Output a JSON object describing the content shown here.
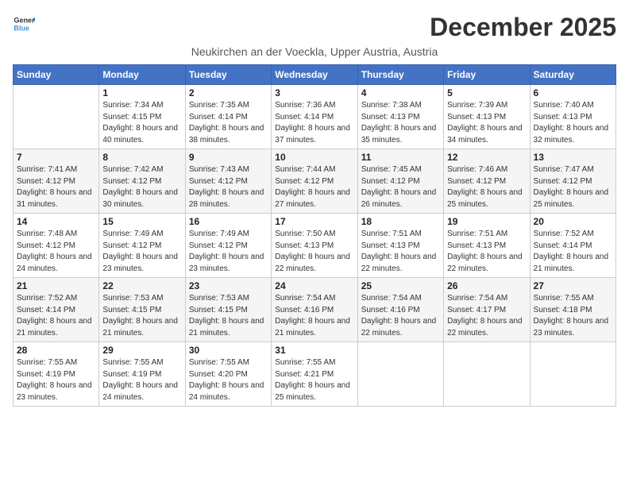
{
  "logo": {
    "line1": "General",
    "line2": "Blue"
  },
  "title": "December 2025",
  "subtitle": "Neukirchen an der Voeckla, Upper Austria, Austria",
  "headers": [
    "Sunday",
    "Monday",
    "Tuesday",
    "Wednesday",
    "Thursday",
    "Friday",
    "Saturday"
  ],
  "weeks": [
    [
      {
        "day": "",
        "sunrise": "",
        "sunset": "",
        "daylight": ""
      },
      {
        "day": "1",
        "sunrise": "Sunrise: 7:34 AM",
        "sunset": "Sunset: 4:15 PM",
        "daylight": "Daylight: 8 hours and 40 minutes."
      },
      {
        "day": "2",
        "sunrise": "Sunrise: 7:35 AM",
        "sunset": "Sunset: 4:14 PM",
        "daylight": "Daylight: 8 hours and 38 minutes."
      },
      {
        "day": "3",
        "sunrise": "Sunrise: 7:36 AM",
        "sunset": "Sunset: 4:14 PM",
        "daylight": "Daylight: 8 hours and 37 minutes."
      },
      {
        "day": "4",
        "sunrise": "Sunrise: 7:38 AM",
        "sunset": "Sunset: 4:13 PM",
        "daylight": "Daylight: 8 hours and 35 minutes."
      },
      {
        "day": "5",
        "sunrise": "Sunrise: 7:39 AM",
        "sunset": "Sunset: 4:13 PM",
        "daylight": "Daylight: 8 hours and 34 minutes."
      },
      {
        "day": "6",
        "sunrise": "Sunrise: 7:40 AM",
        "sunset": "Sunset: 4:13 PM",
        "daylight": "Daylight: 8 hours and 32 minutes."
      }
    ],
    [
      {
        "day": "7",
        "sunrise": "Sunrise: 7:41 AM",
        "sunset": "Sunset: 4:12 PM",
        "daylight": "Daylight: 8 hours and 31 minutes."
      },
      {
        "day": "8",
        "sunrise": "Sunrise: 7:42 AM",
        "sunset": "Sunset: 4:12 PM",
        "daylight": "Daylight: 8 hours and 30 minutes."
      },
      {
        "day": "9",
        "sunrise": "Sunrise: 7:43 AM",
        "sunset": "Sunset: 4:12 PM",
        "daylight": "Daylight: 8 hours and 28 minutes."
      },
      {
        "day": "10",
        "sunrise": "Sunrise: 7:44 AM",
        "sunset": "Sunset: 4:12 PM",
        "daylight": "Daylight: 8 hours and 27 minutes."
      },
      {
        "day": "11",
        "sunrise": "Sunrise: 7:45 AM",
        "sunset": "Sunset: 4:12 PM",
        "daylight": "Daylight: 8 hours and 26 minutes."
      },
      {
        "day": "12",
        "sunrise": "Sunrise: 7:46 AM",
        "sunset": "Sunset: 4:12 PM",
        "daylight": "Daylight: 8 hours and 25 minutes."
      },
      {
        "day": "13",
        "sunrise": "Sunrise: 7:47 AM",
        "sunset": "Sunset: 4:12 PM",
        "daylight": "Daylight: 8 hours and 25 minutes."
      }
    ],
    [
      {
        "day": "14",
        "sunrise": "Sunrise: 7:48 AM",
        "sunset": "Sunset: 4:12 PM",
        "daylight": "Daylight: 8 hours and 24 minutes."
      },
      {
        "day": "15",
        "sunrise": "Sunrise: 7:49 AM",
        "sunset": "Sunset: 4:12 PM",
        "daylight": "Daylight: 8 hours and 23 minutes."
      },
      {
        "day": "16",
        "sunrise": "Sunrise: 7:49 AM",
        "sunset": "Sunset: 4:12 PM",
        "daylight": "Daylight: 8 hours and 23 minutes."
      },
      {
        "day": "17",
        "sunrise": "Sunrise: 7:50 AM",
        "sunset": "Sunset: 4:13 PM",
        "daylight": "Daylight: 8 hours and 22 minutes."
      },
      {
        "day": "18",
        "sunrise": "Sunrise: 7:51 AM",
        "sunset": "Sunset: 4:13 PM",
        "daylight": "Daylight: 8 hours and 22 minutes."
      },
      {
        "day": "19",
        "sunrise": "Sunrise: 7:51 AM",
        "sunset": "Sunset: 4:13 PM",
        "daylight": "Daylight: 8 hours and 22 minutes."
      },
      {
        "day": "20",
        "sunrise": "Sunrise: 7:52 AM",
        "sunset": "Sunset: 4:14 PM",
        "daylight": "Daylight: 8 hours and 21 minutes."
      }
    ],
    [
      {
        "day": "21",
        "sunrise": "Sunrise: 7:52 AM",
        "sunset": "Sunset: 4:14 PM",
        "daylight": "Daylight: 8 hours and 21 minutes."
      },
      {
        "day": "22",
        "sunrise": "Sunrise: 7:53 AM",
        "sunset": "Sunset: 4:15 PM",
        "daylight": "Daylight: 8 hours and 21 minutes."
      },
      {
        "day": "23",
        "sunrise": "Sunrise: 7:53 AM",
        "sunset": "Sunset: 4:15 PM",
        "daylight": "Daylight: 8 hours and 21 minutes."
      },
      {
        "day": "24",
        "sunrise": "Sunrise: 7:54 AM",
        "sunset": "Sunset: 4:16 PM",
        "daylight": "Daylight: 8 hours and 21 minutes."
      },
      {
        "day": "25",
        "sunrise": "Sunrise: 7:54 AM",
        "sunset": "Sunset: 4:16 PM",
        "daylight": "Daylight: 8 hours and 22 minutes."
      },
      {
        "day": "26",
        "sunrise": "Sunrise: 7:54 AM",
        "sunset": "Sunset: 4:17 PM",
        "daylight": "Daylight: 8 hours and 22 minutes."
      },
      {
        "day": "27",
        "sunrise": "Sunrise: 7:55 AM",
        "sunset": "Sunset: 4:18 PM",
        "daylight": "Daylight: 8 hours and 23 minutes."
      }
    ],
    [
      {
        "day": "28",
        "sunrise": "Sunrise: 7:55 AM",
        "sunset": "Sunset: 4:19 PM",
        "daylight": "Daylight: 8 hours and 23 minutes."
      },
      {
        "day": "29",
        "sunrise": "Sunrise: 7:55 AM",
        "sunset": "Sunset: 4:19 PM",
        "daylight": "Daylight: 8 hours and 24 minutes."
      },
      {
        "day": "30",
        "sunrise": "Sunrise: 7:55 AM",
        "sunset": "Sunset: 4:20 PM",
        "daylight": "Daylight: 8 hours and 24 minutes."
      },
      {
        "day": "31",
        "sunrise": "Sunrise: 7:55 AM",
        "sunset": "Sunset: 4:21 PM",
        "daylight": "Daylight: 8 hours and 25 minutes."
      },
      {
        "day": "",
        "sunrise": "",
        "sunset": "",
        "daylight": ""
      },
      {
        "day": "",
        "sunrise": "",
        "sunset": "",
        "daylight": ""
      },
      {
        "day": "",
        "sunrise": "",
        "sunset": "",
        "daylight": ""
      }
    ]
  ]
}
